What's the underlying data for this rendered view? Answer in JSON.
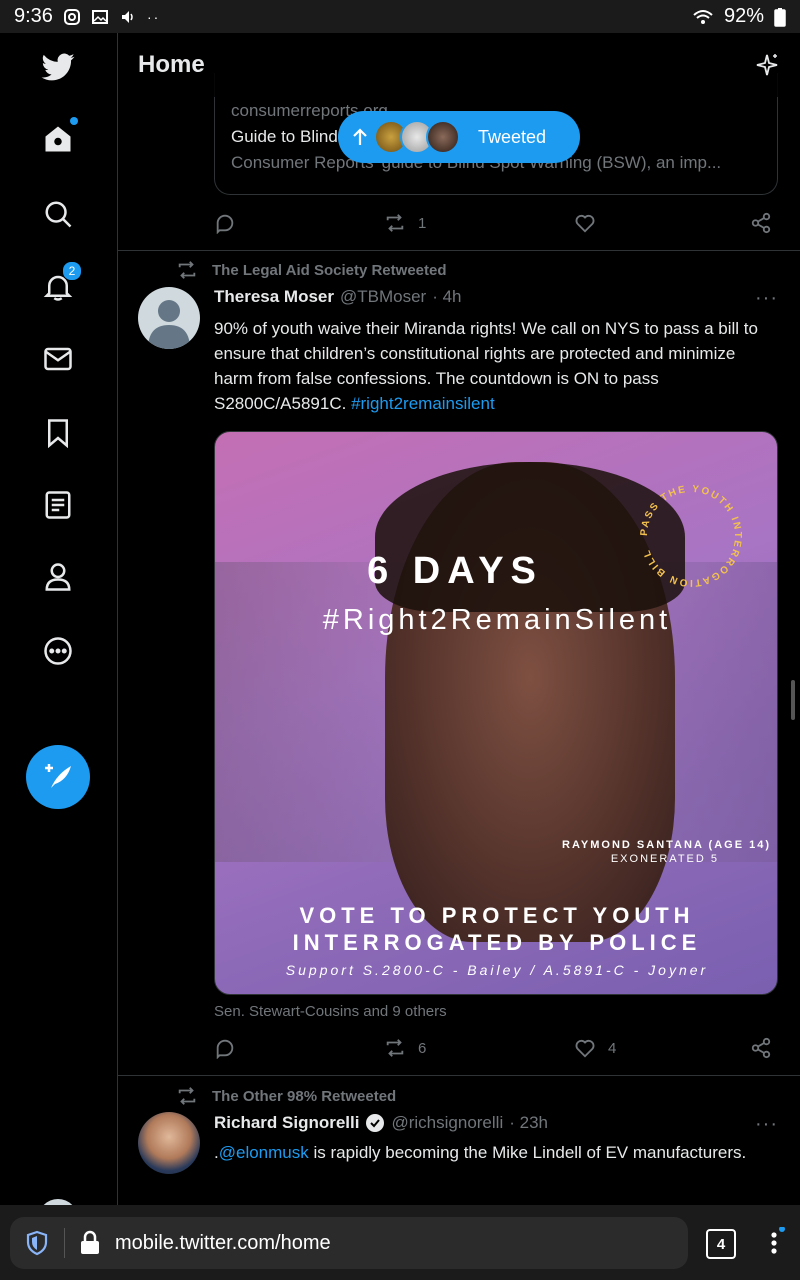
{
  "status_bar": {
    "time": "9:36",
    "battery": "92%",
    "icons": [
      "instagram-icon",
      "gallery-icon",
      "volume-icon",
      "more-dots",
      "wifi-icon",
      "battery-icon"
    ]
  },
  "sidebar": {
    "items": [
      {
        "name": "twitter-logo",
        "label": "Twitter"
      },
      {
        "name": "home",
        "label": "Home",
        "has_dot": true
      },
      {
        "name": "explore",
        "label": "Explore"
      },
      {
        "name": "notifications",
        "label": "Notifications",
        "badge": "2"
      },
      {
        "name": "messages",
        "label": "Messages"
      },
      {
        "name": "bookmarks",
        "label": "Bookmarks"
      },
      {
        "name": "lists",
        "label": "Lists"
      },
      {
        "name": "profile",
        "label": "Profile"
      },
      {
        "name": "more",
        "label": "More"
      }
    ],
    "compose_label": "Tweet"
  },
  "header": {
    "title": "Home"
  },
  "link_card": {
    "domain": "consumerreports.org",
    "title": "Guide to Blind Spot Warning",
    "description": "Consumer Reports' guide to Blind Spot Warning (BSW), an imp..."
  },
  "new_tweets_pill": {
    "label": "Tweeted"
  },
  "tweet0_actions": {
    "replies": "",
    "retweets": "1",
    "likes": ""
  },
  "tweet1": {
    "retweeted_by": "The Legal Aid Society Retweeted",
    "name": "Theresa Moser",
    "handle": "@TBMoser",
    "time": "· 4h",
    "text": "90% of youth waive their Miranda rights! We call on NYS to pass a bill to ensure that children’s constitutional rights are protected and minimize harm from false confessions. The countdown is ON to pass S2800C/A5891C.",
    "hashtag": "#right2remainsilent",
    "media": {
      "days": "6 DAYS",
      "hashtag": "#Right2RemainSilent",
      "circle_text": "PASS THE YOUTH INTERROGATION BILL",
      "subject_name": "RAYMOND SANTANA (AGE 14)",
      "subject_note": "EXONERATED 5",
      "vote_line1": "VOTE TO PROTECT YOUTH",
      "vote_line2": "INTERROGATED BY POLICE",
      "support": "Support S.2800-C - Bailey / A.5891-C - Joyner"
    },
    "social_context": "Sen. Stewart-Cousins and 9 others",
    "replies": "",
    "retweets": "6",
    "likes": "4"
  },
  "tweet2": {
    "retweeted_by": "The Other 98% Retweeted",
    "name": "Richard Signorelli",
    "handle": "@richsignorelli",
    "time": "· 23h",
    "mention_prefix": ".",
    "mention": "@elonmusk",
    "text": " is rapidly becoming the Mike Lindell of EV manufacturers."
  },
  "browser": {
    "url": "mobile.twitter.com/home",
    "tab_count": "4"
  },
  "colors": {
    "accent": "#1d9bf0",
    "background": "#000000",
    "muted_text": "#71767b",
    "border": "#2f3336"
  }
}
